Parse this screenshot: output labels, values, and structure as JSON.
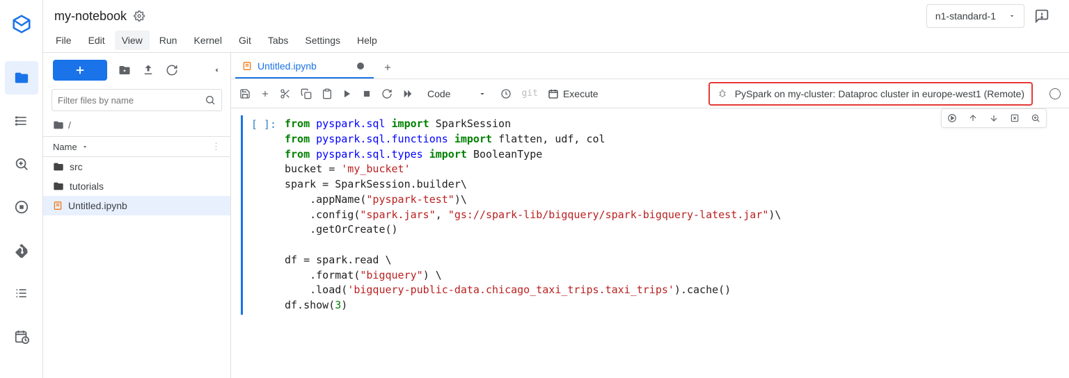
{
  "title": "my-notebook",
  "machine_type": "n1-standard-1",
  "menus": [
    "File",
    "Edit",
    "View",
    "Run",
    "Kernel",
    "Git",
    "Tabs",
    "Settings",
    "Help"
  ],
  "menu_hover_index": 2,
  "file_browser": {
    "filter_placeholder": "Filter files by name",
    "breadcrumb": "/",
    "column": "Name",
    "items": [
      {
        "type": "folder",
        "label": "src"
      },
      {
        "type": "folder",
        "label": "tutorials"
      },
      {
        "type": "notebook",
        "label": "Untitled.ipynb",
        "selected": true
      }
    ]
  },
  "tab": {
    "label": "Untitled.ipynb",
    "dirty": true
  },
  "cell_type": "Code",
  "execute_label": "Execute",
  "git_label": "git",
  "kernel_label": "PySpark on my-cluster: Dataproc cluster in europe-west1 (Remote)",
  "prompt": "[ ]:",
  "code_lines": [
    [
      {
        "t": "from ",
        "c": "k-green"
      },
      {
        "t": "pyspark.sql ",
        "c": "k-blue"
      },
      {
        "t": "import ",
        "c": "k-green"
      },
      {
        "t": "SparkSession"
      }
    ],
    [
      {
        "t": "from ",
        "c": "k-green"
      },
      {
        "t": "pyspark.sql.functions ",
        "c": "k-blue"
      },
      {
        "t": "import ",
        "c": "k-green"
      },
      {
        "t": "flatten, udf, col"
      }
    ],
    [
      {
        "t": "from ",
        "c": "k-green"
      },
      {
        "t": "pyspark.sql.types ",
        "c": "k-blue"
      },
      {
        "t": "import ",
        "c": "k-green"
      },
      {
        "t": "BooleanType"
      }
    ],
    [
      {
        "t": "bucket "
      },
      {
        "t": "= "
      },
      {
        "t": "'my_bucket'",
        "c": "k-str"
      }
    ],
    [
      {
        "t": "spark "
      },
      {
        "t": "= "
      },
      {
        "t": "SparkSession"
      },
      {
        "t": ".",
        "c": ""
      },
      {
        "t": "builder"
      },
      {
        "t": "\\"
      }
    ],
    [
      {
        "t": "    "
      },
      {
        "t": ".",
        "c": ""
      },
      {
        "t": "appName"
      },
      {
        "t": "("
      },
      {
        "t": "\"pyspark-test\"",
        "c": "k-str"
      },
      {
        "t": ")\\"
      }
    ],
    [
      {
        "t": "    "
      },
      {
        "t": ".",
        "c": ""
      },
      {
        "t": "config"
      },
      {
        "t": "("
      },
      {
        "t": "\"spark.jars\"",
        "c": "k-str"
      },
      {
        "t": ", "
      },
      {
        "t": "\"gs://spark-lib/bigquery/spark-bigquery-latest.jar\"",
        "c": "k-str"
      },
      {
        "t": ")\\"
      }
    ],
    [
      {
        "t": "    "
      },
      {
        "t": ".",
        "c": ""
      },
      {
        "t": "getOrCreate"
      },
      {
        "t": "()"
      }
    ],
    [
      {
        "t": ""
      }
    ],
    [
      {
        "t": "df "
      },
      {
        "t": "= "
      },
      {
        "t": "spark"
      },
      {
        "t": ".",
        "c": ""
      },
      {
        "t": "read "
      },
      {
        "t": "\\"
      }
    ],
    [
      {
        "t": "    "
      },
      {
        "t": ".",
        "c": ""
      },
      {
        "t": "format"
      },
      {
        "t": "("
      },
      {
        "t": "\"bigquery\"",
        "c": "k-str"
      },
      {
        "t": ") "
      },
      {
        "t": "\\"
      }
    ],
    [
      {
        "t": "    "
      },
      {
        "t": ".",
        "c": ""
      },
      {
        "t": "load"
      },
      {
        "t": "("
      },
      {
        "t": "'bigquery-public-data.chicago_taxi_trips.taxi_trips'",
        "c": "k-str"
      },
      {
        "t": ")"
      },
      {
        "t": ".",
        "c": ""
      },
      {
        "t": "cache"
      },
      {
        "t": "()"
      }
    ],
    [
      {
        "t": "df"
      },
      {
        "t": ".",
        "c": ""
      },
      {
        "t": "show"
      },
      {
        "t": "("
      },
      {
        "t": "3",
        "c": "k-num"
      },
      {
        "t": ")"
      }
    ]
  ]
}
